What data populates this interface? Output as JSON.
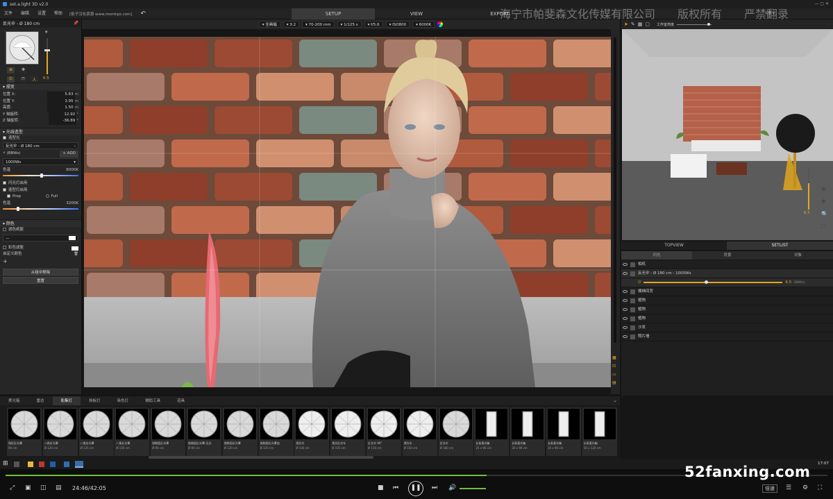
{
  "app": {
    "title": "set.a.light 3D v2.0",
    "subtitle": ""
  },
  "menu": {
    "items": [
      "文件",
      "编辑",
      "设置",
      "帮助"
    ],
    "banner": "[影子汉化资源 www.msmkps.com]",
    "modes": [
      "SETUP",
      "VIEW",
      "EXPORT"
    ],
    "right_label": "设备 ▸",
    "watermark": "海宁市帕斐森文化传媒有限公司　　版权所有　　严禁翻录"
  },
  "viewport_toolbar": [
    "▾ 全画幅",
    "▾ 3:2",
    "▾ 70-200 mm",
    "▾ 1/125 s",
    "▾ f/5.6",
    "▾ ISO800",
    "▾ 6000K"
  ],
  "left": {
    "header": "反光伞 - Ø 180 cm",
    "power_value": "6.5",
    "section_position": "摆变",
    "props": [
      {
        "label": "位置 X:",
        "value": "5.63",
        "unit": "m"
      },
      {
        "label": "位置 Y:",
        "value": "3.95",
        "unit": "m"
      },
      {
        "label": "高度:",
        "value": "1.50",
        "unit": "m"
      },
      {
        "label": "Y 轴旋转:",
        "value": "12.92",
        "unit": "°"
      },
      {
        "label": "Z 轴旋转:",
        "value": "-36.89",
        "unit": "°"
      }
    ],
    "section_light": "光线造型",
    "light_label": "造型光",
    "modifier_value": "反光伞 - Ø 180 cm",
    "flash_label": "(BBWs)",
    "add_label": "ADD",
    "watt_value": "1000Ws",
    "color_label": "色温",
    "color_value": "6000K",
    "chk_flash": "闪光灯启用",
    "chk_model": "造型灯启用",
    "prop_label": "Prop",
    "full_label": "Full",
    "color_label2": "色温",
    "color_value2": "3200K",
    "section_gel": "颜色",
    "gel1": "滤色纸胶",
    "gel_dash": "—",
    "gel2": "彩色滤胶",
    "gel3": "自定义颜色",
    "btn_remove": "从组中移除",
    "btn_reset": "重置"
  },
  "right": {
    "toolbar_label": "工作室亮度",
    "power_value": "6.5",
    "tabs": [
      "TOPVIEW",
      "SETLIST"
    ],
    "subtabs": [
      "闪光",
      "背景",
      "对象"
    ],
    "setlist": [
      "相机",
      "反光伞 - Ø 180 cm - 1000Ws",
      "楼梯间背",
      "植物",
      "植物",
      "植物",
      "沙发",
      "照片墙"
    ],
    "light_row_value": "6.5",
    "light_row_unit": "(BBWs)"
  },
  "lib": {
    "tabs": [
      "柔光箱",
      "雷达",
      "影集灯",
      "挡板灯",
      "染色灯",
      "辅助工具",
      "道具"
    ],
    "active_tab": 2,
    "items": [
      {
        "name": "角形反光罩",
        "size": "90 cm"
      },
      {
        "name": "八角反光罩",
        "size": "Ø 120 cm"
      },
      {
        "name": "八角反光罩",
        "size": "Ø 135 cm"
      },
      {
        "name": "八角反光罩",
        "size": "Ø 150 cm"
      },
      {
        "name": "抛物面反光罩",
        "size": "Ø 90 cm"
      },
      {
        "name": "抛物面反光罩-无光",
        "size": "Ø 90 cm"
      },
      {
        "name": "抛物面反光罩",
        "size": "Ø 120 cm"
      },
      {
        "name": "抛物面反光罩加",
        "size": "Ø 120 cm"
      },
      {
        "name": "透光伞",
        "size": "Ø 100 cm"
      },
      {
        "name": "透光反光伞",
        "size": "Ø 105 cm"
      },
      {
        "name": "反光伞 90°",
        "size": "Ø 150 cm"
      },
      {
        "name": "透光伞",
        "size": "Ø 150 cm"
      },
      {
        "name": "反光伞",
        "size": "Ø 180 cm"
      },
      {
        "name": "长条柔光箱",
        "size": "25 x 90 cm"
      },
      {
        "name": "长条柔光箱",
        "size": "30 x 90 cm"
      },
      {
        "name": "长条柔光箱",
        "size": "35 x 90 cm"
      },
      {
        "name": "长条柔光箱",
        "size": "50 x 120 cm"
      }
    ]
  },
  "taskbar": {
    "time": "17:07"
  },
  "player": {
    "time": "24:46/42:05",
    "speed": "倍速",
    "progress": 0.585
  },
  "watermark_site": "52fanxing.com"
}
